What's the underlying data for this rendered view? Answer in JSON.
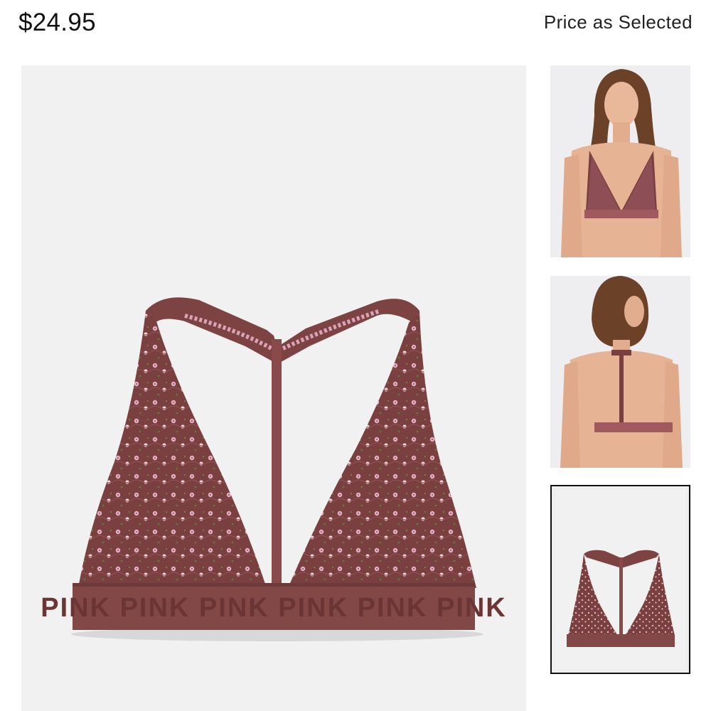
{
  "product": {
    "price": "$24.95",
    "price_note": "Price as Selected",
    "band_text": "PINK PINK PINK PINK PINK PINK",
    "colors": {
      "fabric": "#7a3f3f",
      "band": "#814846",
      "lace_pink": "#d9a3b8",
      "background": "#f1f1f2"
    }
  },
  "gallery": {
    "main_image": "bralette-front-product-shot",
    "thumbnails": [
      {
        "name": "model-front-view"
      },
      {
        "name": "model-back-view"
      },
      {
        "name": "product-flat-view",
        "selected": true
      }
    ]
  }
}
